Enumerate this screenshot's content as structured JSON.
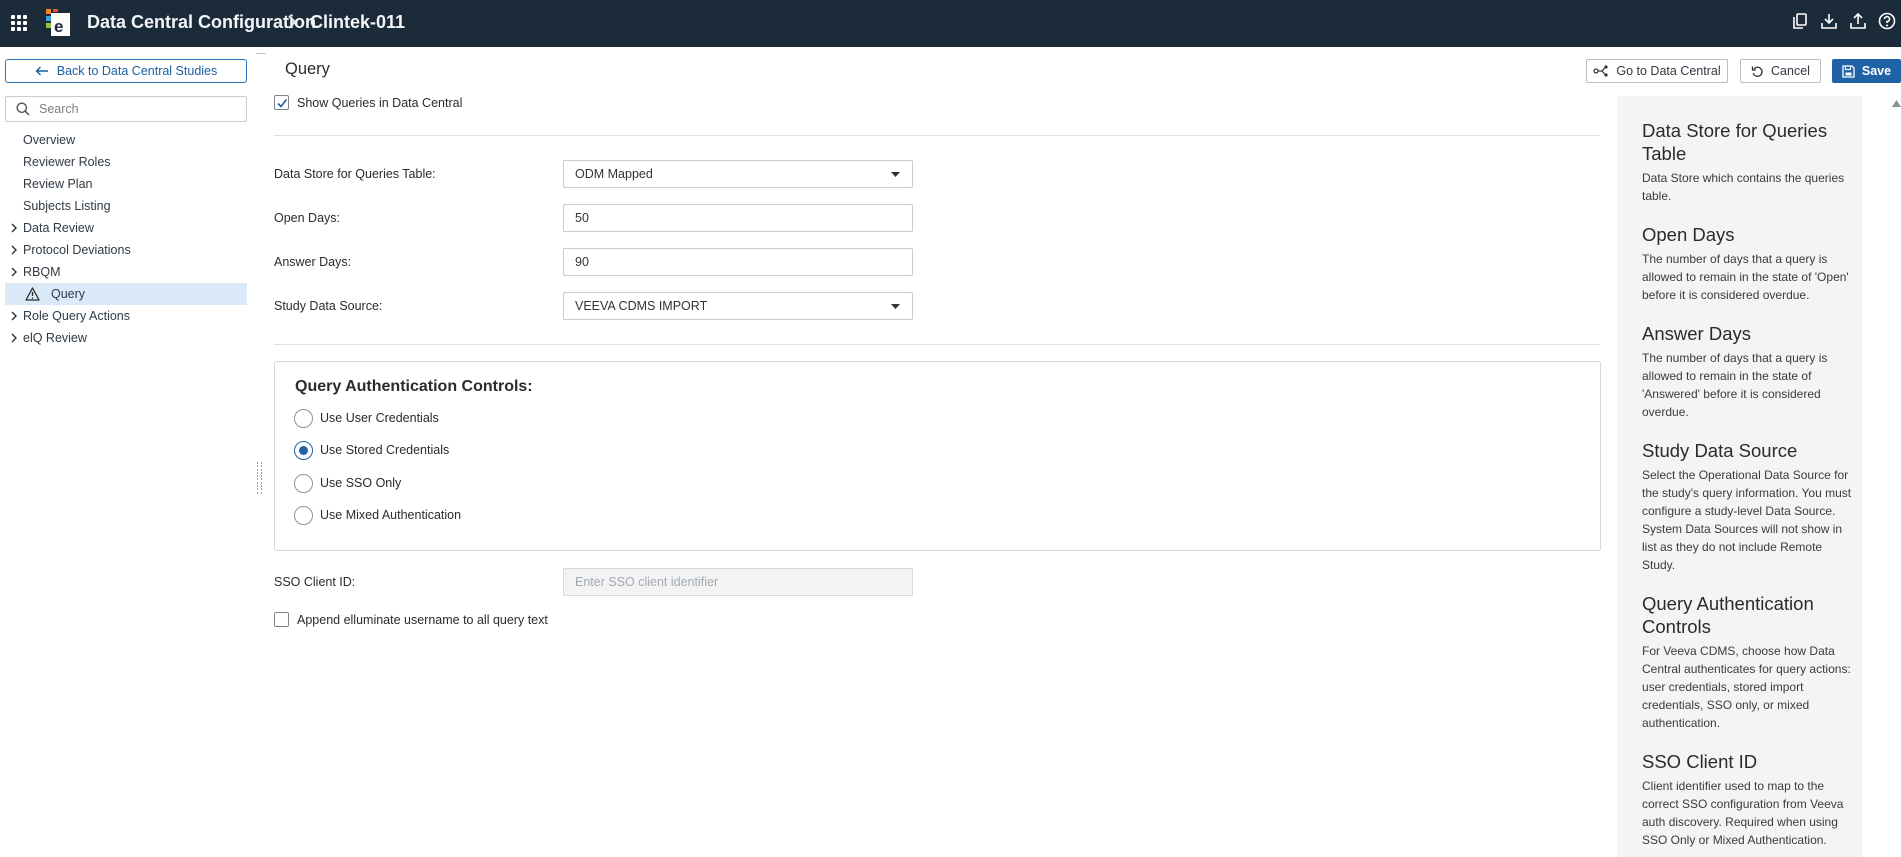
{
  "header": {
    "app_title": "Data Central Configuration",
    "study_name": "Clintek-011",
    "icons": [
      "apps-grid-icon",
      "elluminate-logo-icon",
      "chevron-right-icon",
      "copy-icon",
      "download-icon",
      "upload-icon",
      "help-icon"
    ]
  },
  "sidebar": {
    "back_label": "Back to Data Central Studies",
    "search_placeholder": "Search",
    "items": [
      {
        "label": "Overview"
      },
      {
        "label": "Reviewer Roles"
      },
      {
        "label": "Review Plan"
      },
      {
        "label": "Subjects Listing"
      },
      {
        "label": "Data Review"
      },
      {
        "label": "Protocol Deviations"
      },
      {
        "label": "RBQM"
      },
      {
        "label": "Query"
      },
      {
        "label": "Role Query Actions"
      },
      {
        "label": "elQ Review"
      }
    ]
  },
  "main": {
    "title": "Query",
    "goto_label": "Go to Data Central",
    "cancel_label": "Cancel",
    "save_label": "Save",
    "show_queries_label": "Show Queries in Data Central",
    "show_queries_checked": true,
    "data_store_label": "Data Store for Queries Table:",
    "data_store_value": "ODM Mapped",
    "open_days_label": "Open Days:",
    "open_days_value": "50",
    "answer_days_label": "Answer Days:",
    "answer_days_value": "90",
    "study_source_label": "Study Data Source:",
    "study_source_value": "VEEVA CDMS IMPORT",
    "auth_title": "Query Authentication Controls:",
    "auth_options": [
      {
        "label": "Use User Credentials",
        "selected": false
      },
      {
        "label": "Use Stored Credentials",
        "selected": true
      },
      {
        "label": "Use SSO Only",
        "selected": false
      },
      {
        "label": "Use Mixed Authentication",
        "selected": false
      }
    ],
    "sso_label": "SSO Client ID:",
    "sso_placeholder": "Enter SSO client identifier",
    "append_label": "Append elluminate username to all query text",
    "append_checked": false
  },
  "help": {
    "sections": [
      {
        "heading": "Data Store for Queries Table",
        "text": "Data Store which contains the queries table."
      },
      {
        "heading": "Open Days",
        "text": "The number of days that a query is allowed to remain in the state of 'Open' before it is considered overdue."
      },
      {
        "heading": "Answer Days",
        "text": "The number of days that a query is allowed to remain in the state of 'Answered' before it is considered overdue."
      },
      {
        "heading": "Study Data Source",
        "text": "Select the Operational Data Source for the study's query information. You must configure a study-level Data Source. System Data Sources will not show in list as they do not include Remote Study."
      },
      {
        "heading": "Query Authentication Controls",
        "text": "For Veeva CDMS, choose how Data Central authenticates for query actions: user credentials, stored import credentials, SSO only, or mixed authentication."
      },
      {
        "heading": "SSO Client ID",
        "text": "Client identifier used to map to the correct SSO configuration from Veeva auth discovery. Required when using SSO Only or Mixed Authentication."
      }
    ]
  },
  "colors": {
    "header_bg": "#1c2b3a",
    "primary": "#1f62a5",
    "active_nav_bg": "#dbeaf8",
    "help_bg": "#f3f4f5"
  }
}
